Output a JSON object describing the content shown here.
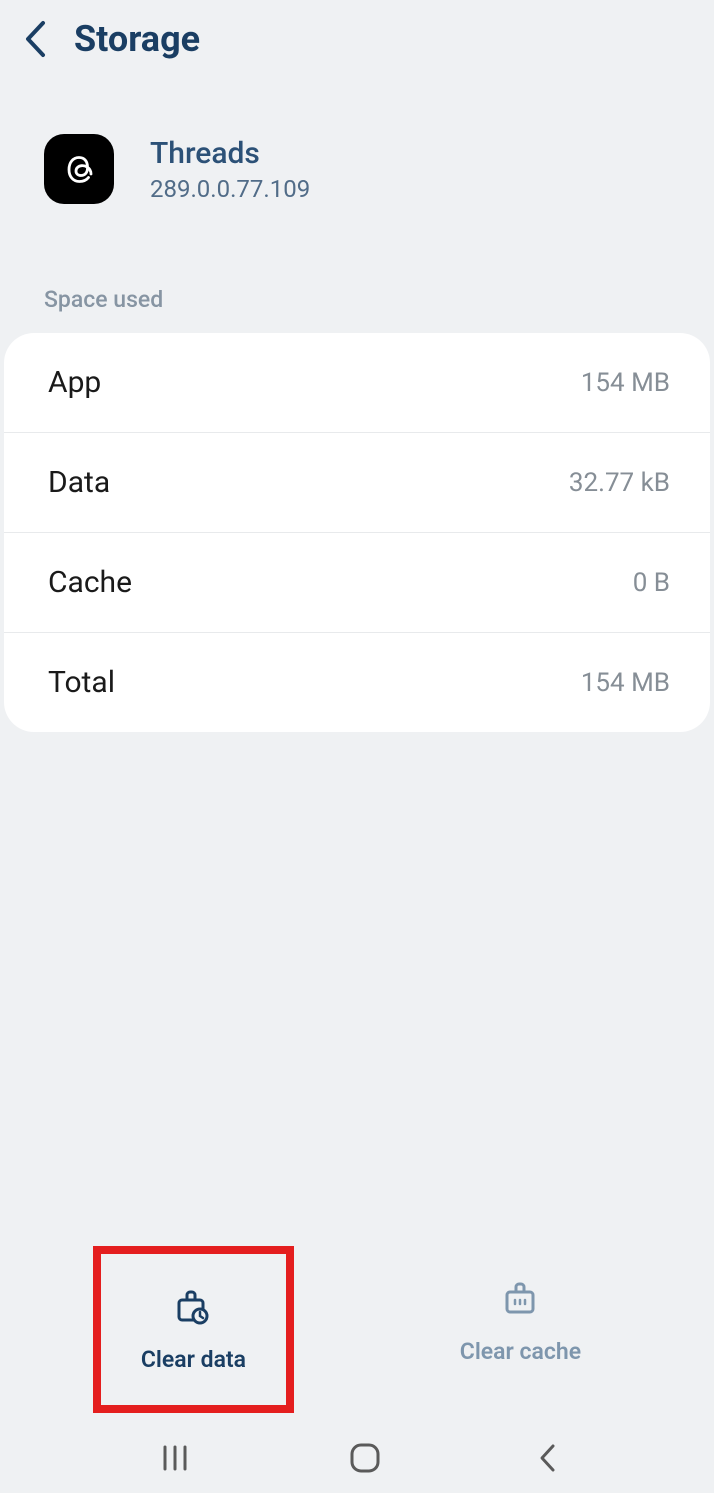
{
  "header": {
    "title": "Storage"
  },
  "app": {
    "name": "Threads",
    "version": "289.0.0.77.109"
  },
  "section": {
    "label": "Space used"
  },
  "storage": {
    "items": [
      {
        "label": "App",
        "value": "154 MB"
      },
      {
        "label": "Data",
        "value": "32.77 kB"
      },
      {
        "label": "Cache",
        "value": "0 B"
      },
      {
        "label": "Total",
        "value": "154 MB"
      }
    ]
  },
  "actions": {
    "clear_data": "Clear data",
    "clear_cache": "Clear cache"
  }
}
